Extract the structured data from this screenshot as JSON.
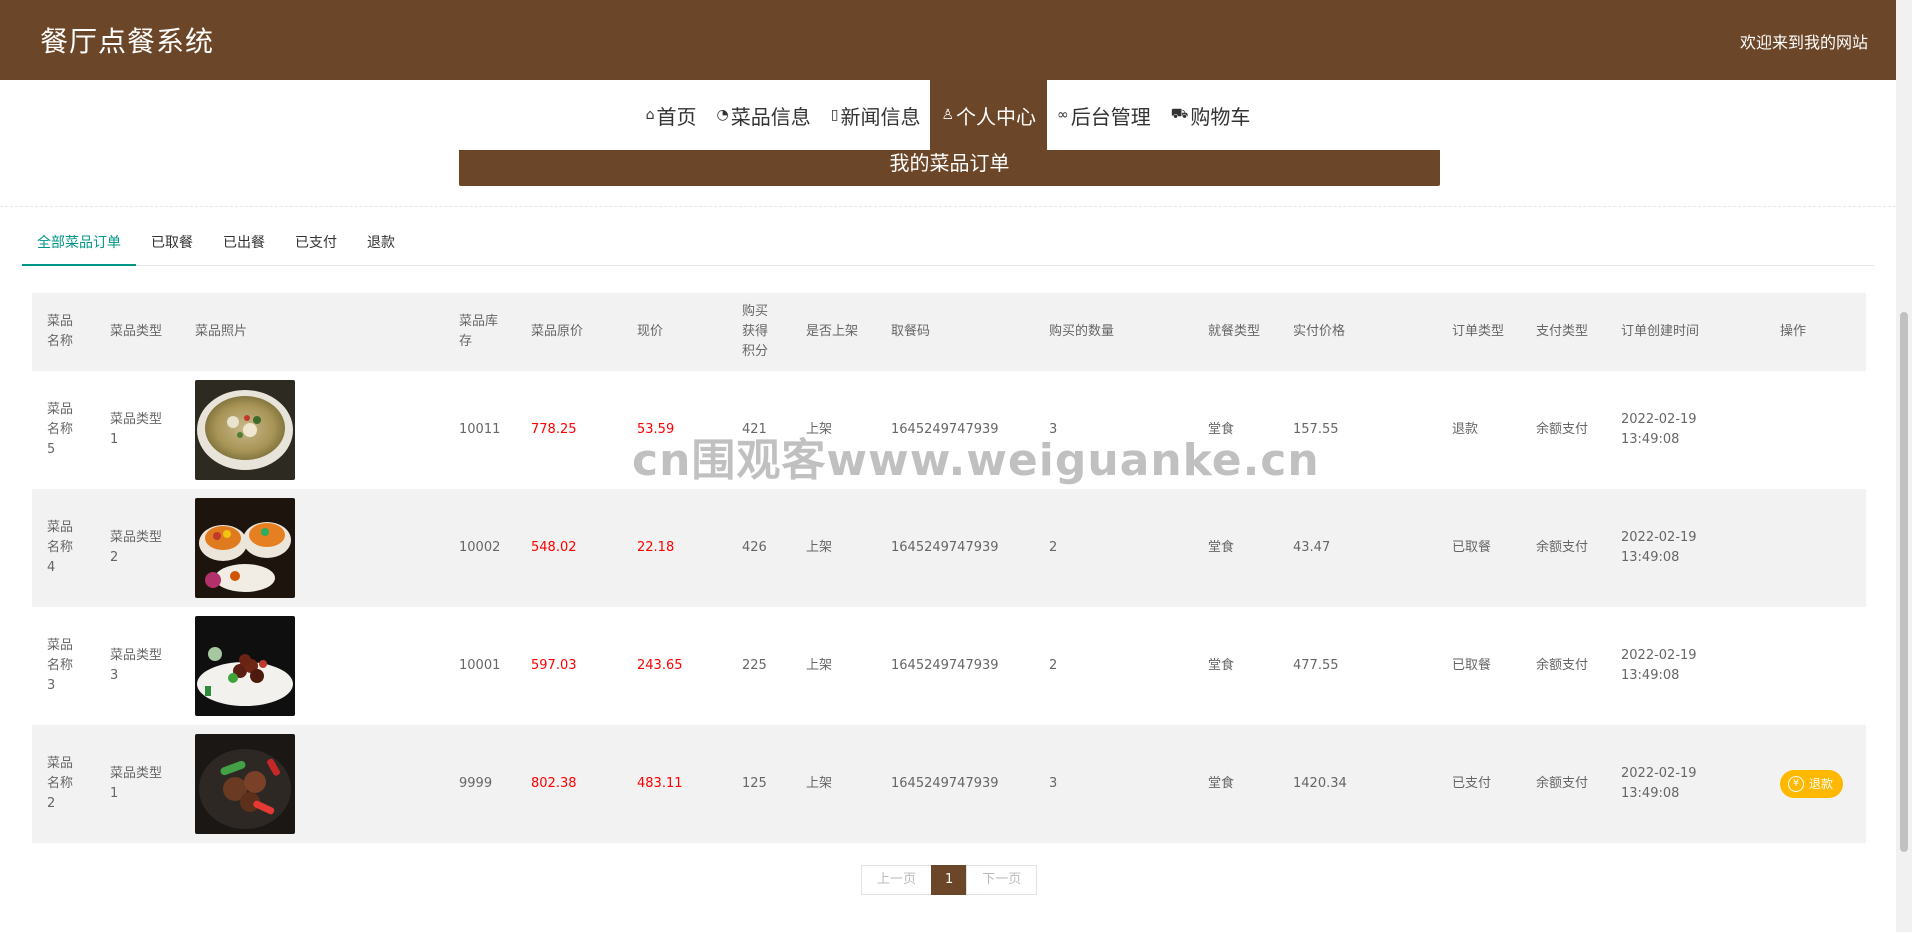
{
  "header": {
    "title": "餐厅点餐系统",
    "welcome": "欢迎来到我的网站"
  },
  "nav": [
    {
      "label": "首页",
      "icon": "home-icon",
      "glyph": "⌂"
    },
    {
      "label": "菜品信息",
      "icon": "palette-icon",
      "glyph": "◔"
    },
    {
      "label": "新闻信息",
      "icon": "document-icon",
      "glyph": "▯"
    },
    {
      "label": "个人中心",
      "icon": "user-icon",
      "glyph": "♙",
      "active": true
    },
    {
      "label": "后台管理",
      "icon": "link-icon",
      "glyph": "∞"
    },
    {
      "label": "购物车",
      "icon": "cart-icon",
      "glyph": "⛟"
    }
  ],
  "banner": {
    "title": "我的菜品订单"
  },
  "tabs": [
    "全部菜品订单",
    "已取餐",
    "已出餐",
    "已支付",
    "退款"
  ],
  "table": {
    "headers": [
      "菜品名称",
      "菜品类型",
      "菜品照片",
      "菜品库存",
      "菜品原价",
      "现价",
      "购买获得积分",
      "是否上架",
      "取餐码",
      "购买的数量",
      "就餐类型",
      "实付价格",
      "订单类型",
      "支付类型",
      "订单创建时间",
      "操作"
    ],
    "rows": [
      {
        "name": "菜品名称5",
        "type": "菜品类型1",
        "photo": "fish-soup",
        "stock": "10011",
        "orig": "778.25",
        "now": "53.59",
        "points": "421",
        "shelf": "上架",
        "code": "1645249747939",
        "qty": "3",
        "dine": "堂食",
        "paid": "157.55",
        "otype": "退款",
        "ptype": "余额支付",
        "time": "2022-02-19 13:49:08",
        "action": ""
      },
      {
        "name": "菜品名称4",
        "type": "菜品类型2",
        "photo": "fruit-bowls",
        "stock": "10002",
        "orig": "548.02",
        "now": "22.18",
        "points": "426",
        "shelf": "上架",
        "code": "1645249747939",
        "qty": "2",
        "dine": "堂食",
        "paid": "43.47",
        "otype": "已取餐",
        "ptype": "余额支付",
        "time": "2022-02-19 13:49:08",
        "action": ""
      },
      {
        "name": "菜品名称3",
        "type": "菜品类型3",
        "photo": "beef-cubes",
        "stock": "10001",
        "orig": "597.03",
        "now": "243.65",
        "points": "225",
        "shelf": "上架",
        "code": "1645249747939",
        "qty": "2",
        "dine": "堂食",
        "paid": "477.55",
        "otype": "已取餐",
        "ptype": "余额支付",
        "time": "2022-02-19 13:49:08",
        "action": ""
      },
      {
        "name": "菜品名称2",
        "type": "菜品类型1",
        "photo": "beef-peppers",
        "stock": "9999",
        "orig": "802.38",
        "now": "483.11",
        "points": "125",
        "shelf": "上架",
        "code": "1645249747939",
        "qty": "3",
        "dine": "堂食",
        "paid": "1420.34",
        "otype": "已支付",
        "ptype": "余额支付",
        "time": "2022-02-19 13:49:08",
        "action": "退款"
      }
    ]
  },
  "pager": {
    "prev": "上一页",
    "current": "1",
    "next": "下一页"
  },
  "watermark": "cn围观客www.weiguanke.cn",
  "colors": {
    "brand": "#6b4628",
    "tabActive": "#009688",
    "price": "#ff0000",
    "refund": "#ffb800"
  }
}
